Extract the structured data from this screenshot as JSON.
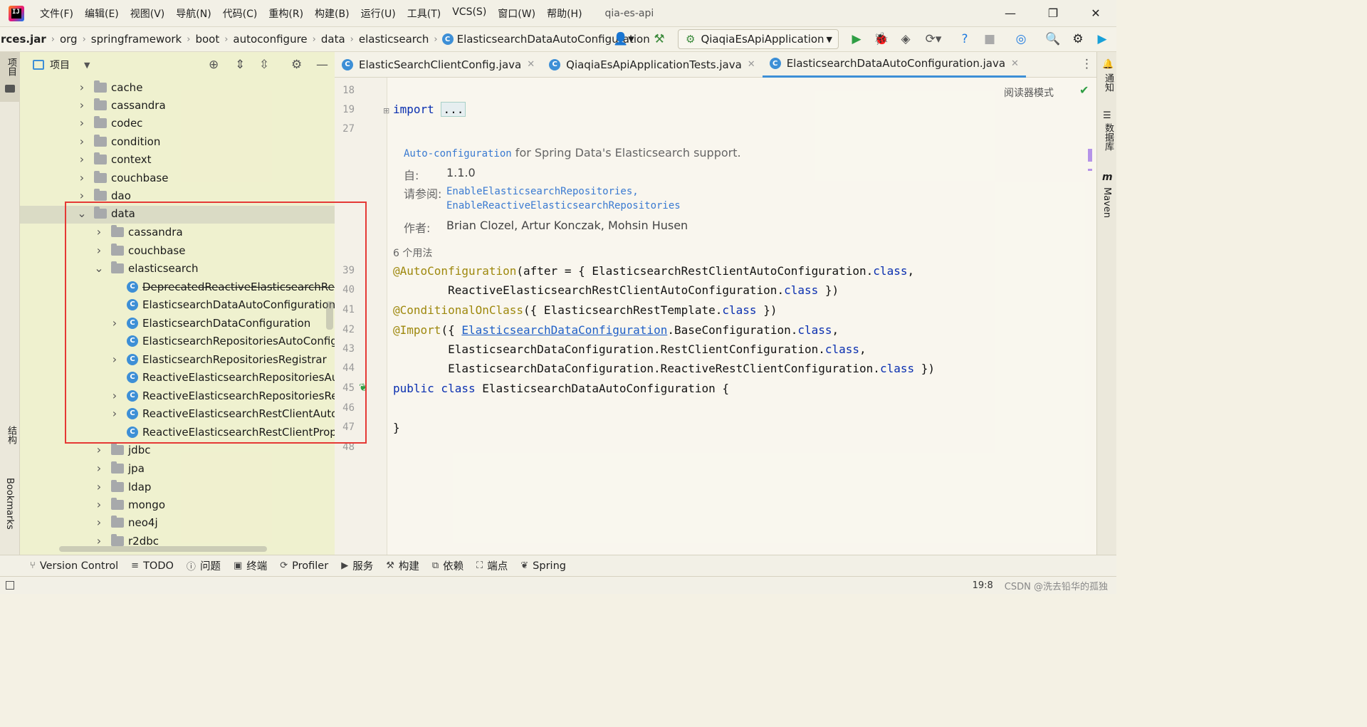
{
  "menubar": {
    "items": [
      "文件(F)",
      "编辑(E)",
      "视图(V)",
      "导航(N)",
      "代码(C)",
      "重构(R)",
      "构建(B)",
      "运行(U)",
      "工具(T)",
      "VCS(S)",
      "窗口(W)",
      "帮助(H)"
    ],
    "project_title": "qia-es-api"
  },
  "breadcrumb": {
    "items": [
      "rces.jar",
      "org",
      "springframework",
      "boot",
      "autoconfigure",
      "data",
      "elasticsearch",
      "ElasticsearchDataAutoConfiguration"
    ]
  },
  "run_config": {
    "label": "QiaqiaEsApiApplication"
  },
  "left_strip": {
    "project": "项目",
    "structure": "结构",
    "bookmarks": "Bookmarks"
  },
  "right_strip": {
    "notifications": "通知",
    "database": "数据库",
    "maven": "Maven"
  },
  "project_panel": {
    "title": "项目",
    "tree": [
      {
        "label": "cache",
        "depth": 0,
        "expanded": false,
        "kind": "folder"
      },
      {
        "label": "cassandra",
        "depth": 0,
        "expanded": false,
        "kind": "folder"
      },
      {
        "label": "codec",
        "depth": 0,
        "expanded": false,
        "kind": "folder"
      },
      {
        "label": "condition",
        "depth": 0,
        "expanded": false,
        "kind": "folder"
      },
      {
        "label": "context",
        "depth": 0,
        "expanded": false,
        "kind": "folder"
      },
      {
        "label": "couchbase",
        "depth": 0,
        "expanded": false,
        "kind": "folder"
      },
      {
        "label": "dao",
        "depth": 0,
        "expanded": false,
        "kind": "folder"
      },
      {
        "label": "data",
        "depth": 0,
        "expanded": true,
        "kind": "folder"
      },
      {
        "label": "cassandra",
        "depth": 1,
        "expanded": false,
        "kind": "folder"
      },
      {
        "label": "couchbase",
        "depth": 1,
        "expanded": false,
        "kind": "folder"
      },
      {
        "label": "elasticsearch",
        "depth": 1,
        "expanded": true,
        "kind": "folder"
      },
      {
        "label": "DeprecatedReactiveElasticsearchRestCl",
        "depth": 2,
        "kind": "class",
        "deprecated": true
      },
      {
        "label": "ElasticsearchDataAutoConfiguration",
        "depth": 2,
        "kind": "class"
      },
      {
        "label": "ElasticsearchDataConfiguration",
        "depth": 2,
        "kind": "class",
        "expandable": true
      },
      {
        "label": "ElasticsearchRepositoriesAutoConfigura",
        "depth": 2,
        "kind": "class"
      },
      {
        "label": "ElasticsearchRepositoriesRegistrar",
        "depth": 2,
        "kind": "class",
        "expandable": true
      },
      {
        "label": "ReactiveElasticsearchRepositoriesAutoC",
        "depth": 2,
        "kind": "class"
      },
      {
        "label": "ReactiveElasticsearchRepositoriesRegis",
        "depth": 2,
        "kind": "class",
        "expandable": true
      },
      {
        "label": "ReactiveElasticsearchRestClientAutoCo",
        "depth": 2,
        "kind": "class",
        "expandable": true
      },
      {
        "label": "ReactiveElasticsearchRestClientProperti",
        "depth": 2,
        "kind": "class"
      },
      {
        "label": "jdbc",
        "depth": 1,
        "expanded": false,
        "kind": "folder"
      },
      {
        "label": "jpa",
        "depth": 1,
        "expanded": false,
        "kind": "folder"
      },
      {
        "label": "ldap",
        "depth": 1,
        "expanded": false,
        "kind": "folder"
      },
      {
        "label": "mongo",
        "depth": 1,
        "expanded": false,
        "kind": "folder"
      },
      {
        "label": "neo4j",
        "depth": 1,
        "expanded": false,
        "kind": "folder"
      },
      {
        "label": "r2dbc",
        "depth": 1,
        "expanded": false,
        "kind": "folder"
      }
    ]
  },
  "editor_tabs": [
    {
      "label": "ElasticSearchClientConfig.java",
      "active": false
    },
    {
      "label": "QiaqiaEsApiApplicationTests.java",
      "active": false
    },
    {
      "label": "ElasticsearchDataAutoConfiguration.java",
      "active": true
    }
  ],
  "editor": {
    "reader_mode": "阅读器模式",
    "line_numbers": [
      "18",
      "19",
      "27",
      "39",
      "40",
      "41",
      "42",
      "43",
      "44",
      "45",
      "46",
      "47",
      "48"
    ],
    "import_kw": "import",
    "import_folded": "...",
    "doc": {
      "summary_link": "Auto-configuration",
      "summary_text": " for Spring Data's Elasticsearch support.",
      "since_label": "自:",
      "since_value": "1.1.0",
      "see_label": "请参阅:",
      "see_1": "EnableElasticsearchRepositories,",
      "see_2": "EnableReactiveElasticsearchRepositories",
      "author_label": "作者:",
      "author_value": "Brian Clozel, Artur Konczak, Mohsin Husen"
    },
    "usages": "6 个用法",
    "code": {
      "l39_ann": "@AutoConfiguration",
      "l39_rest": "(after = { ElasticsearchRestClientAutoConfiguration.",
      "l40": "        ReactiveElasticsearchRestClientAutoConfiguration.",
      "l40_end": " })",
      "l41_ann": "@ConditionalOnClass",
      "l41_rest": "({ ElasticsearchRestTemplate.",
      "l41_end": " })",
      "l42_ann": "@Import",
      "l42_a": "({ ",
      "l42_link": "ElasticsearchDataConfiguration",
      "l42_b": ".BaseConfiguration.",
      "l42_end": ",",
      "l43": "        ElasticsearchDataConfiguration.RestClientConfiguration.",
      "l43_end": ",",
      "l44": "        ElasticsearchDataConfiguration.ReactiveRestClientConfiguration.",
      "l44_end": " })",
      "l45_kw": "public class",
      "l45_rest": " ElasticsearchDataAutoConfiguration {",
      "l47": "}",
      "class_kw": "class"
    }
  },
  "bottom_tools": [
    "Version Control",
    "TODO",
    "问题",
    "终端",
    "Profiler",
    "服务",
    "构建",
    "依赖",
    "端点",
    "Spring"
  ],
  "status": {
    "position": "19:8",
    "watermark": "CSDN @洗去铅华的孤独"
  },
  "colors": {
    "accent": "#3d8fd6",
    "highlight_box": "#e53935",
    "keyword": "#0a2fb0",
    "annotation": "#9e880d"
  }
}
